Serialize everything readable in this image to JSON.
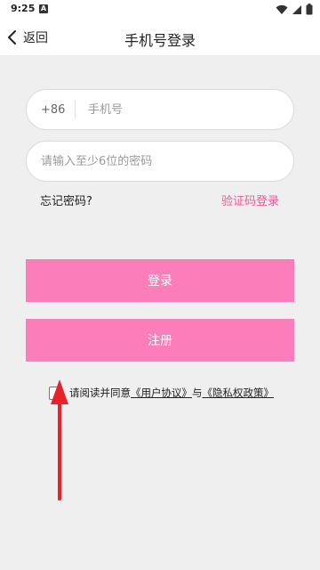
{
  "status_bar": {
    "time": "9:25",
    "notif_icon": "A"
  },
  "header": {
    "back_label": "返回",
    "title": "手机号登录"
  },
  "phone": {
    "country_code": "+86",
    "placeholder": "手机号"
  },
  "password": {
    "placeholder": "请输入至少6位的密码"
  },
  "links": {
    "forgot": "忘记密码?",
    "sms_login": "验证码登录"
  },
  "buttons": {
    "login": "登录",
    "register": "注册"
  },
  "agreement": {
    "prefix": "请阅读并同意",
    "user_agreement": "《用户协议》",
    "conjunction": "与",
    "privacy_policy": "《隐私权政策》"
  },
  "colors": {
    "accent": "#fb7eba",
    "link_pink": "#f0569a",
    "annotation_arrow": "#e8212b"
  }
}
